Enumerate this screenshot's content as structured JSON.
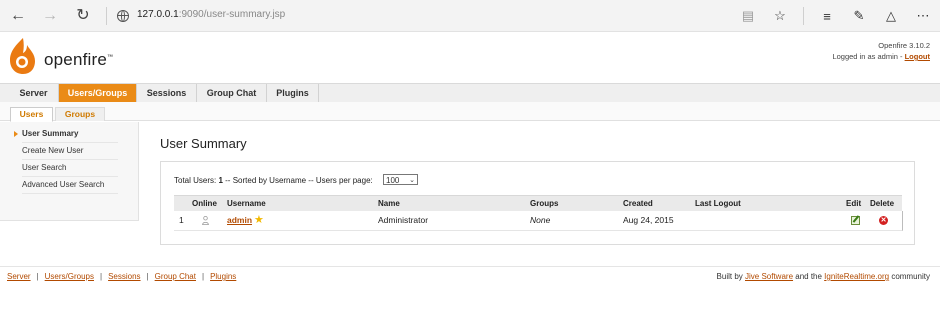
{
  "browser": {
    "url_host": "127.0.0.1",
    "url_rest": ":9090/user-summary.jsp"
  },
  "header": {
    "brand": "openfire",
    "version": "Openfire 3.10.2",
    "logged_in_prefix": "Logged in as admin - ",
    "logout_label": "Logout"
  },
  "main_tabs": [
    {
      "label": "Server"
    },
    {
      "label": "Users/Groups"
    },
    {
      "label": "Sessions"
    },
    {
      "label": "Group Chat"
    },
    {
      "label": "Plugins"
    }
  ],
  "sub_tabs": [
    {
      "label": "Users"
    },
    {
      "label": "Groups"
    }
  ],
  "sidebar": {
    "items": [
      {
        "label": "User Summary"
      },
      {
        "label": "Create New User"
      },
      {
        "label": "User Search"
      },
      {
        "label": "Advanced User Search"
      }
    ]
  },
  "content": {
    "title": "User Summary",
    "summary_prefix": "Total Users: ",
    "total_users": "1",
    "summary_suffix": " -- Sorted by Username -- Users per page:",
    "per_page": "100"
  },
  "table": {
    "headers": {
      "online": "Online",
      "username": "Username",
      "name": "Name",
      "groups": "Groups",
      "created": "Created",
      "last_logout": "Last Logout",
      "edit": "Edit",
      "delete": "Delete"
    },
    "rows": [
      {
        "index": "1",
        "username": "admin",
        "name": "Administrator",
        "groups": "None",
        "created": "Aug 24, 2015",
        "last_logout": ""
      }
    ]
  },
  "footer": {
    "links": [
      "Server",
      "Users/Groups",
      "Sessions",
      "Group Chat",
      "Plugins"
    ],
    "built_by": "Built by ",
    "jive": "Jive Software",
    "and_the": " and the ",
    "ignite": "IgniteRealtime.org",
    "community": " community"
  },
  "colors": {
    "accent": "#ea8b17",
    "link": "#b24a00"
  }
}
